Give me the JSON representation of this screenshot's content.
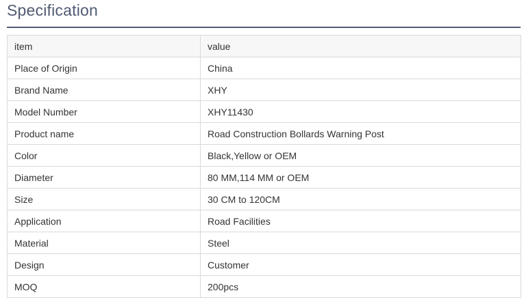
{
  "page": {
    "title": "Specification"
  },
  "table": {
    "header": {
      "item": "item",
      "value": "value"
    },
    "rows": [
      {
        "item": "Place of Origin",
        "value": "China"
      },
      {
        "item": "Brand Name",
        "value": "XHY"
      },
      {
        "item": "Model Number",
        "value": "XHY11430"
      },
      {
        "item": "Product name",
        "value": "Road Construction Bollards Warning Post"
      },
      {
        "item": "Color",
        "value": "Black,Yellow or OEM"
      },
      {
        "item": "Diameter",
        "value": "80 MM,114 MM or OEM"
      },
      {
        "item": "Size",
        "value": "30 CM to 120CM"
      },
      {
        "item": "Application",
        "value": "Road Facilities"
      },
      {
        "item": "Material",
        "value": "Steel"
      },
      {
        "item": "Design",
        "value": "Customer"
      },
      {
        "item": "MOQ",
        "value": "200pcs"
      }
    ]
  }
}
